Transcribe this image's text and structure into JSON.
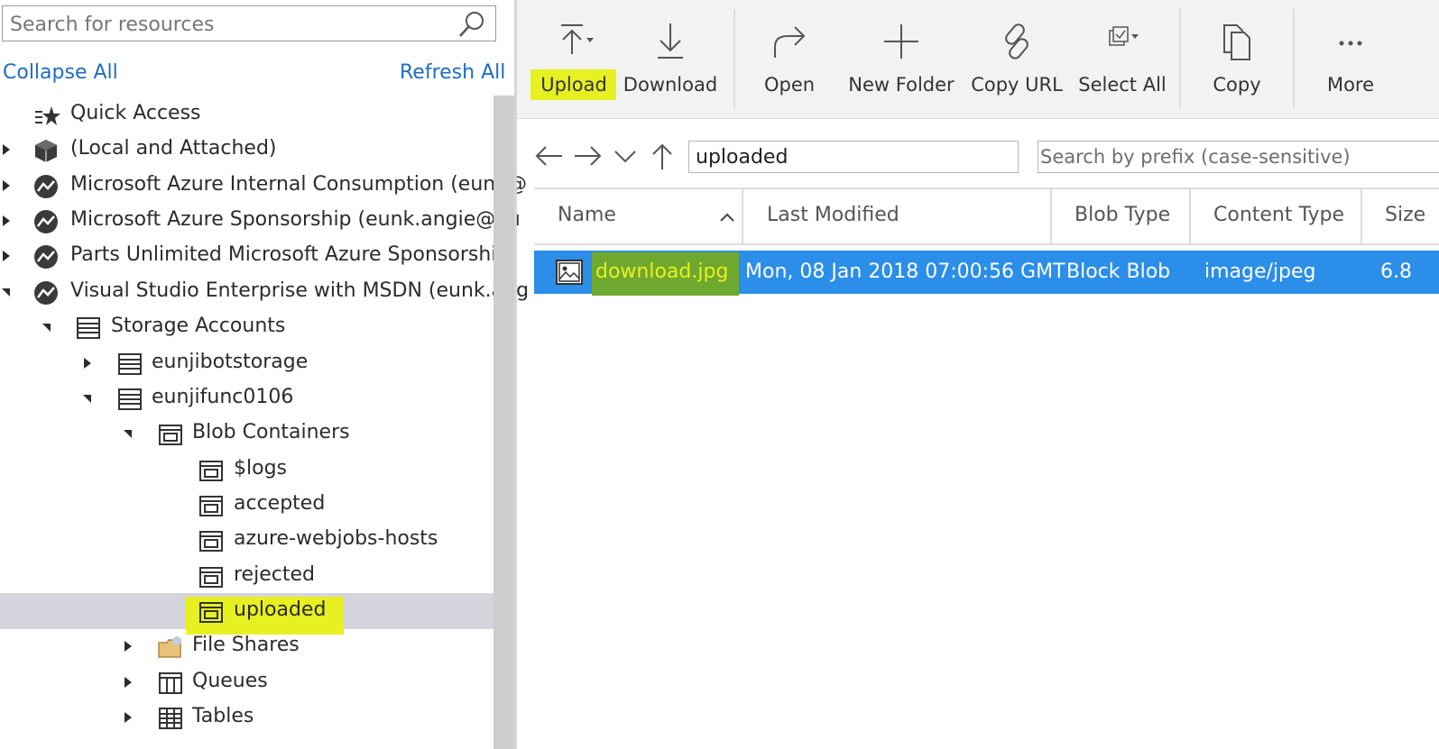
{
  "left_panel": {
    "search_placeholder": "Search for resources",
    "collapse_all": "Collapse All",
    "refresh_all": "Refresh All",
    "tree": [
      {
        "label": "Quick Access",
        "icon": "quick-access-icon"
      },
      {
        "label": "(Local and Attached)",
        "icon": "cube-icon"
      },
      {
        "label": "Microsoft Azure Internal Consumption (eunk@",
        "icon": "subscription-icon"
      },
      {
        "label": "Microsoft Azure Sponsorship (eunk.angie@ou",
        "icon": "subscription-icon"
      },
      {
        "label": "Parts Unlimited Microsoft Azure Sponsorship",
        "icon": "subscription-icon"
      },
      {
        "label": "Visual Studio Enterprise with MSDN (eunk.ang",
        "icon": "subscription-icon"
      },
      {
        "label": "Storage Accounts",
        "icon": "storage-icon"
      },
      {
        "label": "eunjibotstorage",
        "icon": "storage-icon"
      },
      {
        "label": "eunjifunc0106",
        "icon": "storage-icon"
      },
      {
        "label": "Blob Containers",
        "icon": "container-icon"
      },
      {
        "label": "$logs",
        "icon": "container-icon"
      },
      {
        "label": "accepted",
        "icon": "container-icon"
      },
      {
        "label": "azure-webjobs-hosts",
        "icon": "container-icon"
      },
      {
        "label": "rejected",
        "icon": "container-icon"
      },
      {
        "label": "uploaded",
        "icon": "container-icon"
      },
      {
        "label": "File Shares",
        "icon": "file-shares-icon"
      },
      {
        "label": "Queues",
        "icon": "queues-icon"
      },
      {
        "label": "Tables",
        "icon": "tables-icon"
      }
    ]
  },
  "toolbar": {
    "upload": "Upload",
    "download": "Download",
    "open": "Open",
    "new_folder": "New Folder",
    "copy_url": "Copy URL",
    "select_all": "Select All",
    "copy": "Copy",
    "more": "More"
  },
  "navigation": {
    "path": "uploaded",
    "prefix_placeholder": "Search by prefix (case-sensitive)"
  },
  "grid": {
    "columns": [
      "Name",
      "Last Modified",
      "Blob Type",
      "Content Type",
      "Size"
    ],
    "rows": [
      {
        "name": "download.jpg",
        "last_modified": "Mon, 08 Jan 2018 07:00:56 GMT",
        "blob_type": "Block Blob",
        "content_type": "image/jpeg",
        "size": "6.8"
      }
    ]
  },
  "colors": {
    "highlight": "#e7f020",
    "selection": "#2b8ee8",
    "link": "#1f6cc2"
  }
}
